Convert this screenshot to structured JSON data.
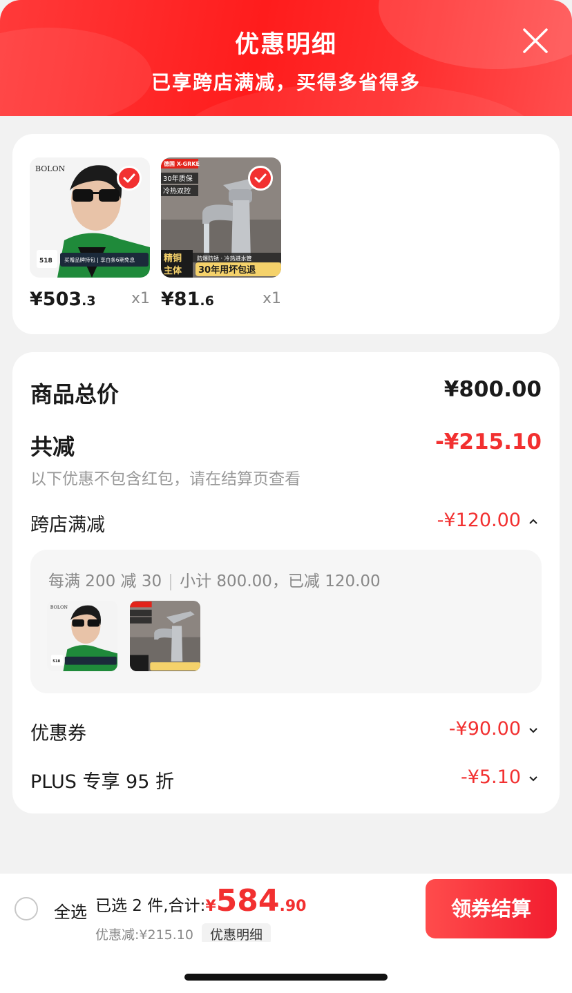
{
  "header": {
    "title": "优惠明细",
    "subtitle": "已享跨店满减，买得多省得多",
    "close_icon": "close-icon"
  },
  "products": [
    {
      "name": "BOLON sunglasses",
      "brand_text": "BOLON",
      "promo_text": "买赠品牌持包 | 享白条6期免息",
      "price_int": "¥503",
      "price_dec": ".3",
      "qty": "x1",
      "selected": true
    },
    {
      "name": "X-GRKE faucet",
      "brand_text": "X-GRKE",
      "tag1": "30年质保",
      "tag2": "冷热双控",
      "badge_left": "精铜主体",
      "badge_right": "30年用坏包退",
      "price_int": "¥81",
      "price_dec": ".6",
      "qty": "x1",
      "selected": true
    }
  ],
  "summary": {
    "total_label": "商品总价",
    "total_value": "¥800.00",
    "reduce_label": "共减",
    "reduce_value": "-¥215.10",
    "reduce_hint": "以下优惠不包含红包，请在结算页查看",
    "cross_store": {
      "label": "跨店满减",
      "value": "-¥120.00",
      "rule": "每满 200 减 30",
      "subtotal": "小计 800.00，已减 120.00"
    },
    "coupon": {
      "label": "优惠券",
      "value": "-¥90.00"
    },
    "plus": {
      "label": "PLUS 专享 95 折",
      "value": "-¥5.10"
    }
  },
  "bottom_bar": {
    "select_all": "全选",
    "selected_text": "已选 2 件,合计:",
    "currency": "¥",
    "total_int": "584",
    "total_dec": ".90",
    "discount_text": "优惠减:¥215.10",
    "detail_chip": "优惠明细",
    "checkout_label": "领券结算"
  },
  "colors": {
    "accent": "#f23030",
    "header_red": "#ff2a2a"
  }
}
